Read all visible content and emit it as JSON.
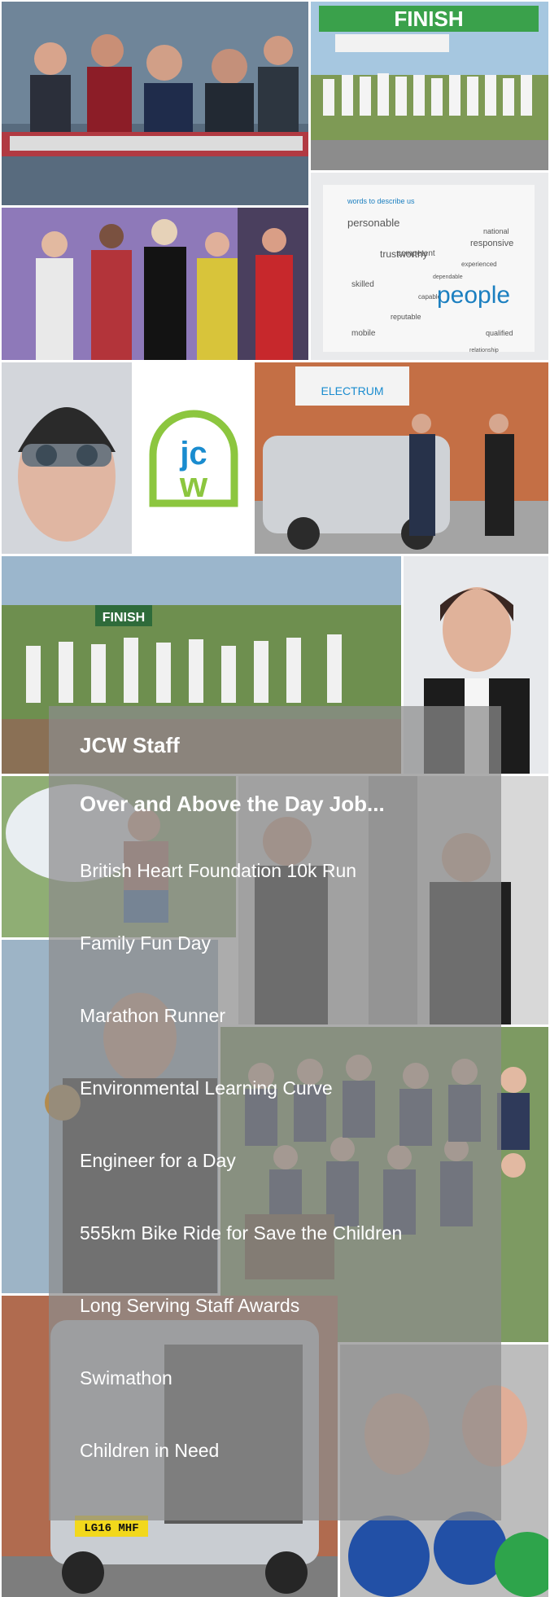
{
  "overlay": {
    "heading": "JCW Staff",
    "subheading": "Over and Above the Day Job...",
    "items": [
      "British Heart Foundation 10k Run",
      "Family Fun Day",
      "Marathon Runner",
      "Environmental Learning Curve",
      "Engineer for a Day",
      "555km Bike Ride for Save the Children",
      "Long Serving Staff Awards",
      "Swimathon",
      "Children in Need"
    ]
  },
  "logo": {
    "letters": "jcw",
    "green": "#8cc63f",
    "blue": "#1a8ccf"
  },
  "photo_signs": {
    "finish_banner": "FINISH",
    "finish_sign": "FINISH",
    "electrum_sign": "ELECTRUM",
    "number_plate": "LG16 MHF"
  },
  "word_cloud": {
    "header": "words to describe us",
    "words": [
      "personable",
      "national",
      "trustworthy",
      "competent",
      "responsive",
      "skilled",
      "capable",
      "people",
      "reputable",
      "mobile",
      "qualified",
      "experienced",
      "dependable",
      "relationship"
    ]
  },
  "colors": {
    "overlay": "#8c8c8c",
    "text": "#ffffff"
  }
}
